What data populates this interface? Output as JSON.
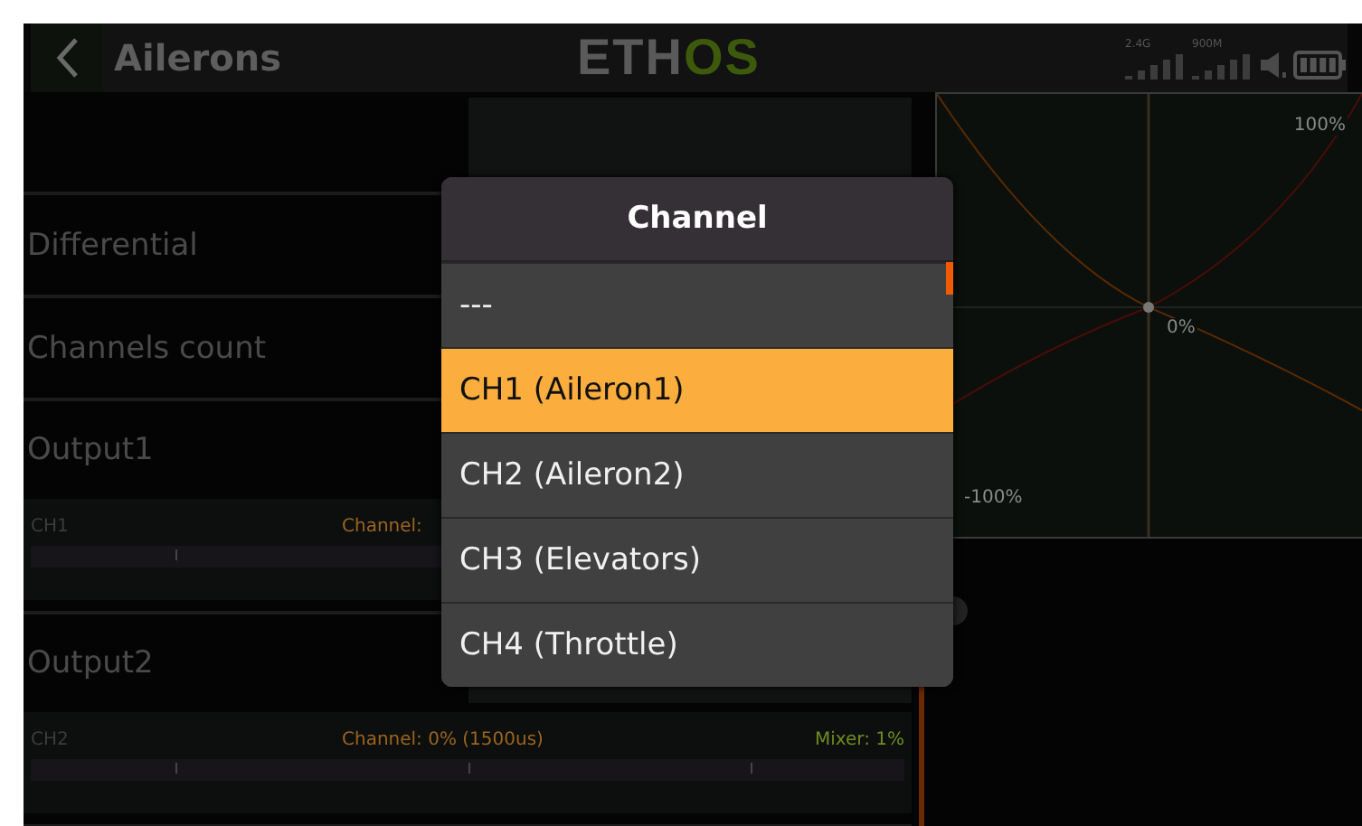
{
  "header": {
    "title": "Ailerons",
    "logo_main": "ETH",
    "logo_accent": "OS",
    "rf_labels": [
      "2.4G",
      "900M"
    ]
  },
  "rows": [
    {
      "kind": "button",
      "label": ""
    },
    {
      "kind": "field",
      "label": "Differential"
    },
    {
      "kind": "field",
      "label": "Channels count"
    },
    {
      "kind": "output",
      "label": "Output1",
      "channel": "CH1",
      "channel_reading": "Channel:",
      "mixer_reading": ""
    },
    {
      "kind": "output",
      "label": "Output2",
      "channel": "CH2",
      "channel_reading": "Channel: 0% (1500us)",
      "mixer_reading": "Mixer: 1%"
    }
  ],
  "graph": {
    "top_label": "100%",
    "center_label": "0%",
    "bottom_label": "-100%"
  },
  "popup": {
    "title": "Channel",
    "items": [
      {
        "label": "---",
        "selected": false
      },
      {
        "label": "CH1 (Aileron1)",
        "selected": true
      },
      {
        "label": "CH2 (Aileron2)",
        "selected": false
      },
      {
        "label": "CH3 (Elevators)",
        "selected": false
      },
      {
        "label": "CH4 (Throttle)",
        "selected": false
      }
    ]
  }
}
